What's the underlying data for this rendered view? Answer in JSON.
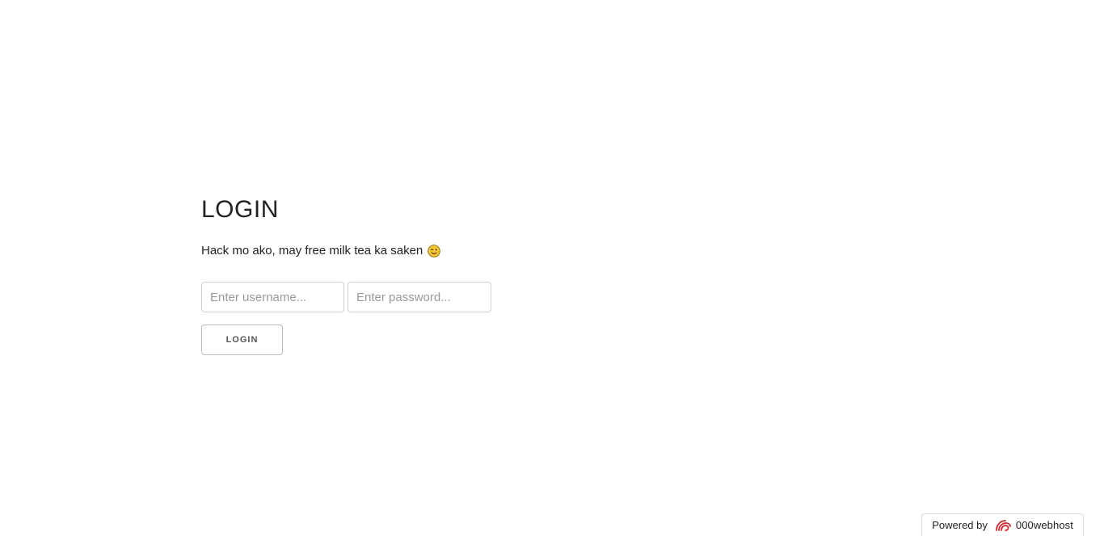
{
  "login": {
    "title": "LOGIN",
    "tagline": "Hack mo ako, may free milk tea ka saken",
    "tagline_emoji": "wink-face-icon",
    "username_placeholder": "Enter username...",
    "password_placeholder": "Enter password...",
    "username_value": "",
    "password_value": "",
    "button_label": "LOGIN"
  },
  "footer": {
    "powered_by": "Powered by",
    "host_name": "000webhost",
    "logo_icon": "000webhost-logo-icon",
    "logo_color": "#d6262b"
  }
}
